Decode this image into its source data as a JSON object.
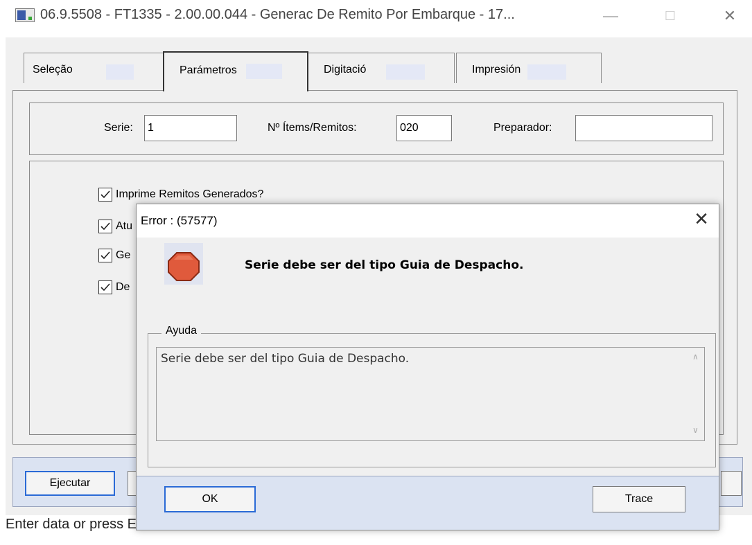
{
  "window": {
    "title": "06.9.5508 - FT1335 - 2.00.00.044 - Generac De Remito Por Embarque - 17...",
    "minimize_glyph": "—",
    "maximize_glyph": "☐",
    "close_glyph": "✕"
  },
  "tabs": [
    {
      "label": "Seleção",
      "active": false
    },
    {
      "label": "Parámetros",
      "active": true
    },
    {
      "label": "Digitació",
      "active": false
    },
    {
      "label": "Impresión",
      "active": false
    }
  ],
  "params": {
    "serie_label": "Serie:",
    "serie_value": "1",
    "items_label": "Nº Ítems/Remitos:",
    "items_value": "020",
    "preparador_label": "Preparador:",
    "preparador_value": ""
  },
  "checkboxes": [
    {
      "label": "Imprime Remitos Generados?",
      "checked": true
    },
    {
      "label": "Atu",
      "checked": true
    },
    {
      "label": "Ge",
      "checked": true
    },
    {
      "label": "De",
      "checked": true
    }
  ],
  "footer": {
    "execute_label": "Ejecutar"
  },
  "status_bar": {
    "text": "Enter data or press ESC to end."
  },
  "dialog": {
    "title": "Error : (57577)",
    "close_glyph": "✕",
    "icon": "stop-icon",
    "message": "Serie debe ser del tipo Guia de Despacho.",
    "help_legend": "Ayuda",
    "help_text": "Serie debe ser del tipo Guia de Despacho.",
    "ok_label": "OK",
    "trace_label": "Trace"
  },
  "colors": {
    "accent_focus": "#2a6ad6",
    "stop_red": "#e05a3c",
    "footer_bg": "#dbe3f2"
  }
}
